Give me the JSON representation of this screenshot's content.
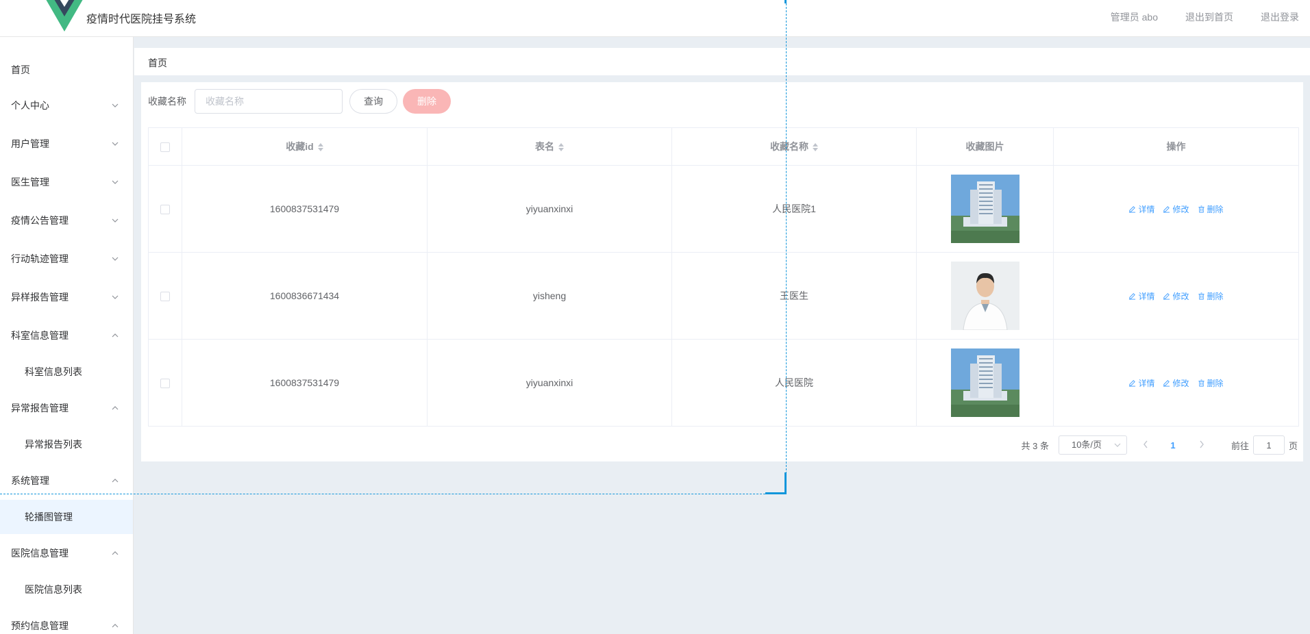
{
  "header": {
    "title": "疫情时代医院挂号系统",
    "user_label": "管理员 abo",
    "exit_home": "退出到首页",
    "logout": "退出登录"
  },
  "sidebar": {
    "home": "首页",
    "items": [
      {
        "label": "个人中心",
        "expanded": false
      },
      {
        "label": "用户管理",
        "expanded": false
      },
      {
        "label": "医生管理",
        "expanded": false
      },
      {
        "label": "疫情公告管理",
        "expanded": false
      },
      {
        "label": "行动轨迹管理",
        "expanded": false
      },
      {
        "label": "异样报告管理",
        "expanded": false
      },
      {
        "label": "科室信息管理",
        "expanded": true,
        "sub": "科室信息列表"
      },
      {
        "label": "异常报告管理",
        "expanded": true,
        "sub": "异常报告列表"
      },
      {
        "label": "系统管理",
        "expanded": true,
        "sub": "轮播图管理"
      },
      {
        "label": "医院信息管理",
        "expanded": true,
        "sub": "医院信息列表"
      },
      {
        "label": "预约信息管理",
        "expanded": true
      }
    ]
  },
  "breadcrumb": "首页",
  "search": {
    "label": "收藏名称",
    "placeholder": "收藏名称",
    "value": "",
    "query_button": "查询",
    "delete_button": "删除"
  },
  "table": {
    "columns": [
      "收藏id",
      "表名",
      "收藏名称",
      "收藏图片",
      "操作"
    ],
    "rows": [
      {
        "id": "1600837531479",
        "table_name": "yiyuanxinxi",
        "name": "人民医院1",
        "image": "hospital-building"
      },
      {
        "id": "1600836671434",
        "table_name": "yisheng",
        "name": "王医生",
        "image": "doctor-portrait"
      },
      {
        "id": "1600837531479",
        "table_name": "yiyuanxinxi",
        "name": "人民医院",
        "image": "hospital-building"
      }
    ],
    "actions": {
      "detail": "详情",
      "edit": "修改",
      "delete": "删除"
    }
  },
  "pagination": {
    "total": "共 3 条",
    "page_size": "10条/页",
    "current_page": "1",
    "goto_label": "前往",
    "goto_value": "1",
    "page_suffix": "页"
  },
  "colors": {
    "accent": "#409eff",
    "delete_disabled": "#fab6b6",
    "selection_dash": "#1296db",
    "logo_green": "#42b983",
    "logo_dark": "#35495e"
  }
}
